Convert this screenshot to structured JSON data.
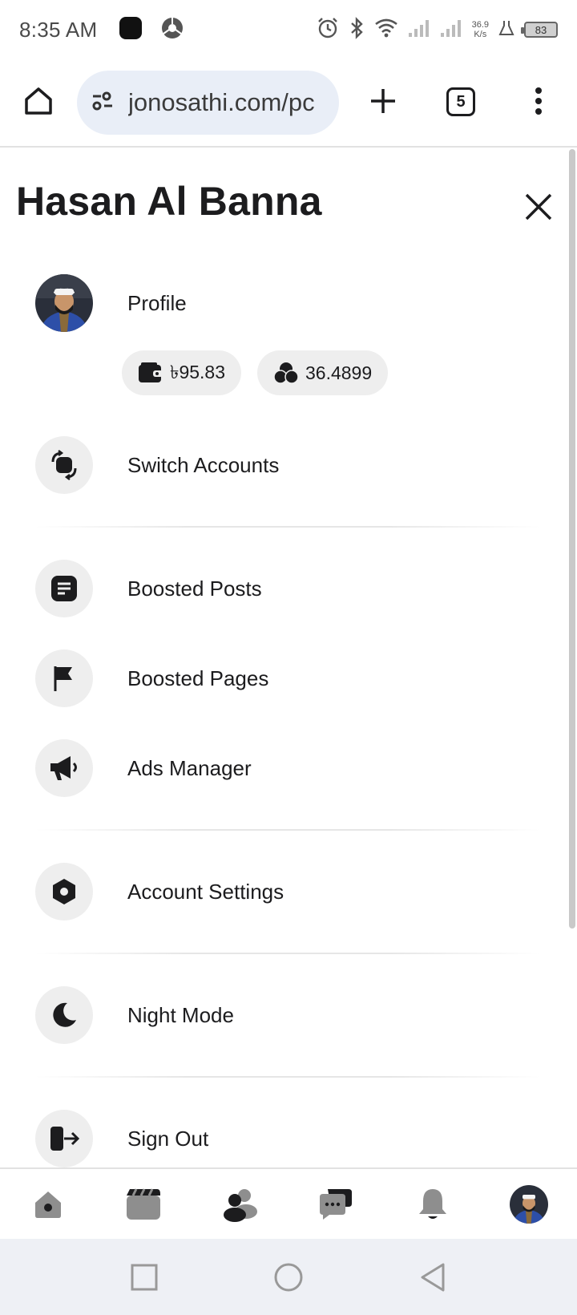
{
  "status_bar": {
    "time": "8:35 AM",
    "net_speed_value": "36.9",
    "net_speed_unit": "K/s",
    "battery": "83"
  },
  "browser": {
    "url": "jonosathi.com/pc",
    "tab_count": "5"
  },
  "drawer": {
    "title": "Hasan Al Banna",
    "profile_label": "Profile",
    "wallet_balance": "৳95.83",
    "points_balance": "36.4899",
    "items": [
      {
        "label": "Switch Accounts",
        "icon": "switch-accounts-icon"
      },
      {
        "label": "Boosted Posts",
        "icon": "document-icon"
      },
      {
        "label": "Boosted Pages",
        "icon": "flag-icon"
      },
      {
        "label": "Ads Manager",
        "icon": "megaphone-icon"
      },
      {
        "label": "Account Settings",
        "icon": "settings-hex-icon"
      },
      {
        "label": "Night Mode",
        "icon": "moon-icon"
      },
      {
        "label": "Sign Out",
        "icon": "sign-out-icon"
      }
    ]
  },
  "bottom_nav": [
    "home-icon",
    "video-icon",
    "friends-icon",
    "messages-icon",
    "notifications-icon",
    "profile-avatar"
  ],
  "colors": {
    "icon_bg": "#eeeeee",
    "url_bg": "#e9eef7",
    "system_nav_bg": "#eef0f5",
    "text": "#1c1c1e"
  }
}
